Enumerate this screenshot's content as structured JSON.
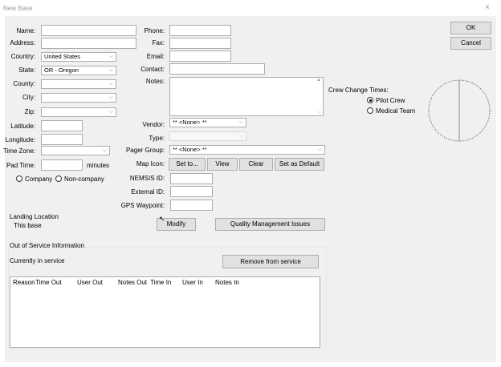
{
  "window": {
    "title": "New Base",
    "close_glyph": "×"
  },
  "labels": {
    "name": "Name:",
    "address": "Address:",
    "country": "Country:",
    "state": "State:",
    "county": "County:",
    "city": "City:",
    "zip": "Zip:",
    "latitude": "Latitude:",
    "longitude": "Longitude:",
    "time_zone": "Time Zone:",
    "pad_time": "Pad Time:",
    "minutes": "minutes",
    "phone": "Phone:",
    "fax": "Fax:",
    "email": "Email:",
    "contact": "Contact:",
    "notes": "Notes:",
    "vendor": "Vendor:",
    "type": "Type:",
    "pager_group": "Pager Group:",
    "map_icon": "Map Icon:",
    "nemsis_id": "NEMSIS ID:",
    "external_id": "External ID:",
    "gps_waypoint": "GPS Waypoint:",
    "crew_change_times": "Crew Change Times:"
  },
  "values": {
    "country": "United States",
    "state": "OR - Oregon",
    "vendor": "** <None> **",
    "pager_group": "** <None> **"
  },
  "radios": {
    "company": "Company",
    "non_company": "Non-company",
    "pilot_crew": "Pilot Crew",
    "medical_team": "Medical Team"
  },
  "buttons": {
    "ok": "OK",
    "cancel": "Cancel",
    "set_to": "Set to...",
    "view": "View",
    "clear": "Clear",
    "set_as_default": "Set as Default",
    "modify": "Modify",
    "quality_management": "Quality Management Issues",
    "remove_from_service": "Remove from service"
  },
  "landing": {
    "label": "Landing Location",
    "value": "This base"
  },
  "out_of_service": {
    "label": "Out of Service Information",
    "status": "Currently in service",
    "columns": [
      "Reason",
      "Time Out",
      "User Out",
      "Notes Out",
      "Time In",
      "User In",
      "Notes In"
    ]
  },
  "icons": {
    "dropdown": "chevron-down-icon",
    "cursor": "mouse-pointer-icon"
  }
}
